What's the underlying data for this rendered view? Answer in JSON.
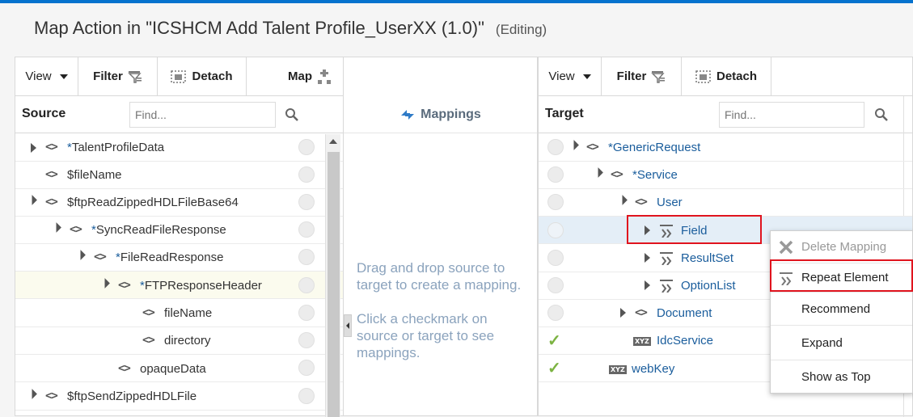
{
  "title": {
    "main": "Map Action in \"ICSHCM Add Talent Profile_UserXX (1.0)\"",
    "status": "(Editing)"
  },
  "source_panel": {
    "toolbar": {
      "view": "View",
      "filter": "Filter",
      "detach": "Detach",
      "map": "Map"
    },
    "header": "Source",
    "find_placeholder": "Find...",
    "rows": [
      {
        "star": "*",
        "name": "TalentProfileData"
      },
      {
        "star": "",
        "name": "$fileName"
      },
      {
        "star": "",
        "name": "$ftpReadZippedHDLFileBase64"
      },
      {
        "star": "*",
        "name": "SyncReadFileResponse"
      },
      {
        "star": "*",
        "name": "FileReadResponse"
      },
      {
        "star": "*",
        "name": "FTPResponseHeader"
      },
      {
        "star": "",
        "name": "fileName"
      },
      {
        "star": "",
        "name": "directory"
      },
      {
        "star": "",
        "name": "opaqueData"
      },
      {
        "star": "",
        "name": "$ftpSendZippedHDLFile"
      }
    ]
  },
  "mappings_panel": {
    "header": "Mappings",
    "hint1": "Drag and drop source to target to create a mapping.",
    "hint2": "Click a checkmark on source or target to see mappings."
  },
  "target_panel": {
    "toolbar": {
      "view": "View",
      "filter": "Filter",
      "detach": "Detach"
    },
    "header": "Target",
    "find_placeholder": "Find...",
    "rows": [
      {
        "star": "*",
        "name": "GenericRequest"
      },
      {
        "star": "*",
        "name": "Service"
      },
      {
        "star": "",
        "name": "User"
      },
      {
        "star": "",
        "name": "Field"
      },
      {
        "star": "",
        "name": "ResultSet"
      },
      {
        "star": "",
        "name": "OptionList"
      },
      {
        "star": "",
        "name": "Document"
      },
      {
        "star": "",
        "name": "IdcService"
      },
      {
        "star": "",
        "name": "webKey"
      }
    ]
  },
  "context_menu": {
    "items": [
      "Delete Mapping",
      "Repeat Element",
      "Recommend",
      "Expand",
      "Show as Top"
    ]
  },
  "icons": {
    "xyz_label": "XYZ",
    "check": "✓"
  }
}
